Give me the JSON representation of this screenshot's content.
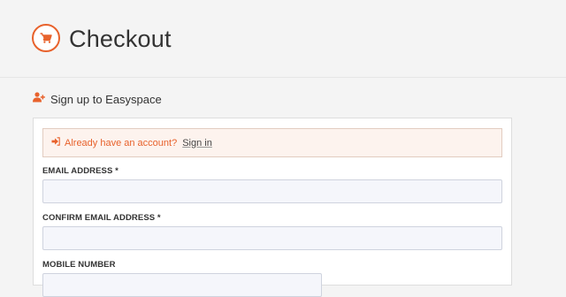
{
  "header": {
    "title": "Checkout",
    "icon": "shopping-cart-icon"
  },
  "section": {
    "title": "Sign up to Easyspace",
    "icon": "user-plus-icon"
  },
  "signin_notice": {
    "icon": "sign-in-icon",
    "question": "Already have an account?",
    "link": "Sign in"
  },
  "form": {
    "email_label": "EMAIL ADDRESS *",
    "email_value": "",
    "confirm_email_label": "CONFIRM EMAIL ADDRESS *",
    "confirm_email_value": "",
    "mobile_label": "MOBILE NUMBER",
    "mobile_value": ""
  },
  "colors": {
    "accent": "#e8622c",
    "notice_bg": "#fdf3ee",
    "input_bg": "#f5f6fb"
  }
}
